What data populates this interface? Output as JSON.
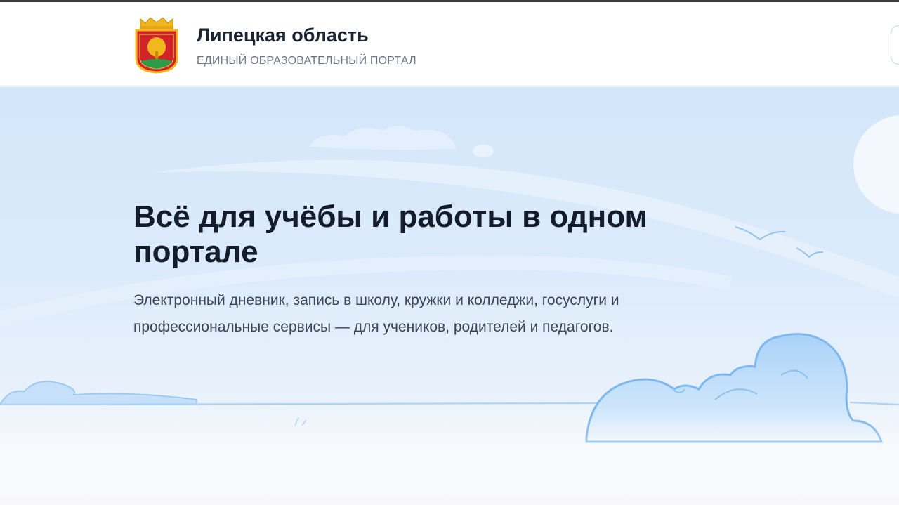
{
  "header": {
    "title": "Липецкая область",
    "subtitle": "ЕДИНЫЙ ОБРАЗОВАТЕЛЬНЫЙ ПОРТАЛ",
    "emblem_icon": "lipetsk-coat-of-arms",
    "right_button_icon": "menu-icon"
  },
  "hero": {
    "title": "Всё для учёбы и работы в одном портале",
    "description": "Электронный дневник, запись в школу, кружки и колледжи, госуслуги и профессиональные сервисы — для учеников, родителей и педагогов."
  },
  "colors": {
    "sky": "#d3e6fa",
    "cloud_fill": "#b9daf7",
    "cloud_outline": "#7db8ee",
    "title_text": "#141c2b",
    "emblem_red": "#d2232a",
    "emblem_gold": "#f0b81c",
    "emblem_green": "#2e9b47"
  }
}
